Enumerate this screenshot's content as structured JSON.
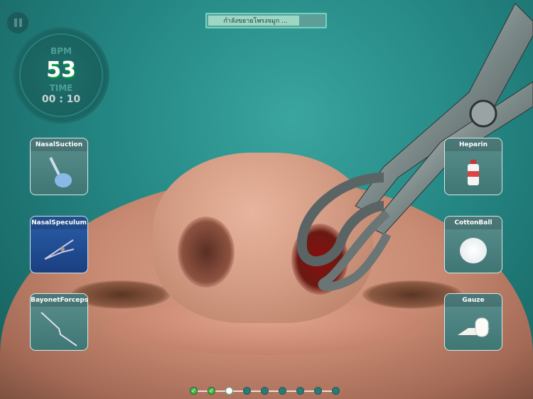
{
  "status_bar": {
    "label": "กำลังขยายโพรงจมูก ...",
    "progress_percent": 80
  },
  "vitals": {
    "bpm_label": "BPM",
    "bpm_value": "53",
    "time_label": "TIME",
    "time_value": "00 : 10"
  },
  "tools_left": [
    {
      "label": "NasalSuction",
      "selected": false
    },
    {
      "label": "NasalSpeculum",
      "selected": true
    },
    {
      "label": "BayonetForceps",
      "selected": false
    }
  ],
  "tools_right": [
    {
      "label": "Heparin"
    },
    {
      "label": "CottonBall"
    },
    {
      "label": "Gauze"
    }
  ],
  "steps": {
    "total": 9,
    "completed": 2,
    "current": 3
  },
  "colors": {
    "accent": "#6fd4bf",
    "selected_tool": "#2a5ea8",
    "done_step": "#4cbb3a"
  }
}
